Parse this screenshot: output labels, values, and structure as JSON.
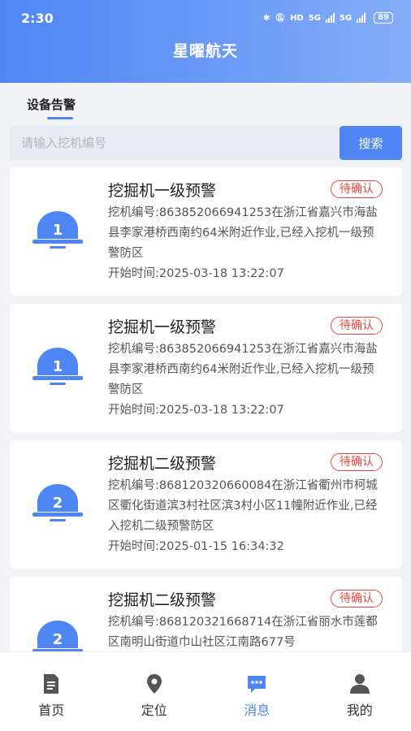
{
  "status": {
    "time": "2:30",
    "network1": "5G",
    "network2": "5G",
    "hd": "HD",
    "battery": "89"
  },
  "app": {
    "title": "星曜航天"
  },
  "tabs": {
    "active": "设备告警"
  },
  "search": {
    "placeholder": "请输入挖机编号",
    "value": "",
    "button": "搜索"
  },
  "alerts": [
    {
      "level": "1",
      "title": "挖掘机一级预警",
      "badge": "待确认",
      "desc": "挖机编号:863852066941253在浙江省嘉兴市海盐县李家港桥西南约64米附近作业,已经入挖机一级预警防区",
      "time": "开始时间:2025-03-18 13:22:07"
    },
    {
      "level": "1",
      "title": "挖掘机一级预警",
      "badge": "待确认",
      "desc": "挖机编号:863852066941253在浙江省嘉兴市海盐县李家港桥西南约64米附近作业,已经入挖机一级预警防区",
      "time": "开始时间:2025-03-18 13:22:07"
    },
    {
      "level": "2",
      "title": "挖掘机二级预警",
      "badge": "待确认",
      "desc": "挖机编号:868120320660084在浙江省衢州市柯城区衢化街道滨3村社区滨3村小区11幢附近作业,已经入挖机二级预警防区",
      "time": "开始时间:2025-01-15 16:34:32"
    },
    {
      "level": "2",
      "title": "挖掘机二级预警",
      "badge": "待确认",
      "desc": "挖机编号:868120321668714在浙江省丽水市莲都区南明山街道巾山社区江南路677号",
      "time": ""
    }
  ],
  "nav": [
    {
      "label": "首页",
      "icon": "document-icon"
    },
    {
      "label": "定位",
      "icon": "location-pin-icon"
    },
    {
      "label": "消息",
      "icon": "message-icon"
    },
    {
      "label": "我的",
      "icon": "user-icon"
    }
  ],
  "colors": {
    "accent": "#4f86f5",
    "alert_badge": "#e5483f",
    "background": "#f2f3f7"
  }
}
